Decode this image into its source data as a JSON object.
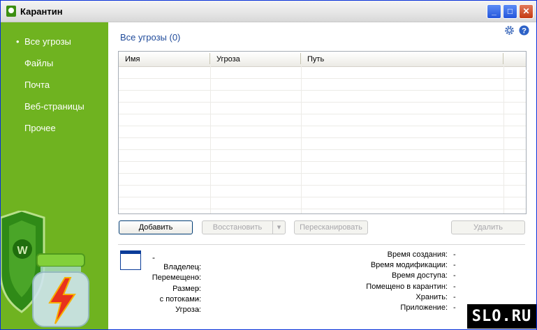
{
  "window": {
    "title": "Карантин",
    "controls": [
      "_",
      "□",
      "✕"
    ]
  },
  "sidebar": {
    "items": [
      {
        "label": "Все угрозы",
        "active": true
      },
      {
        "label": "Файлы",
        "active": false
      },
      {
        "label": "Почта",
        "active": false
      },
      {
        "label": "Веб-страницы",
        "active": false
      },
      {
        "label": "Прочее",
        "active": false
      }
    ],
    "bullet": "•"
  },
  "main": {
    "heading": "Все угрозы (0)",
    "top_icons": [
      "gear-icon",
      "help-icon"
    ],
    "table": {
      "columns": [
        "Имя",
        "Угроза",
        "Путь"
      ],
      "rows": []
    },
    "buttons": {
      "add": "Добавить",
      "restore": "Восстановить",
      "restore_arrow": "▾",
      "rescan": "Пересканировать",
      "delete": "Удалить"
    },
    "details": {
      "name": "-",
      "left": [
        {
          "label": "Владелец:",
          "value": "-"
        },
        {
          "label": "Перемещено:",
          "value": "-"
        },
        {
          "label": "Размер:",
          "value": "-"
        },
        {
          "label": "с потоками:",
          "value": "-"
        },
        {
          "label": "Угроза:",
          "value": "-"
        }
      ],
      "right": [
        {
          "label": "Время создания:",
          "value": "-"
        },
        {
          "label": "Время модификации:",
          "value": "-"
        },
        {
          "label": "Время доступа:",
          "value": "-"
        },
        {
          "label": "Помещено в карантин:",
          "value": "-"
        },
        {
          "label": "Хранить:",
          "value": "-"
        },
        {
          "label": "Приложение:",
          "value": "-"
        }
      ]
    }
  },
  "watermark": "SLO.RU",
  "colors": {
    "sidebar": "#6fb320",
    "heading": "#1f4a9a",
    "titlebar_btn": "#2456db",
    "close_btn": "#c43a12"
  }
}
